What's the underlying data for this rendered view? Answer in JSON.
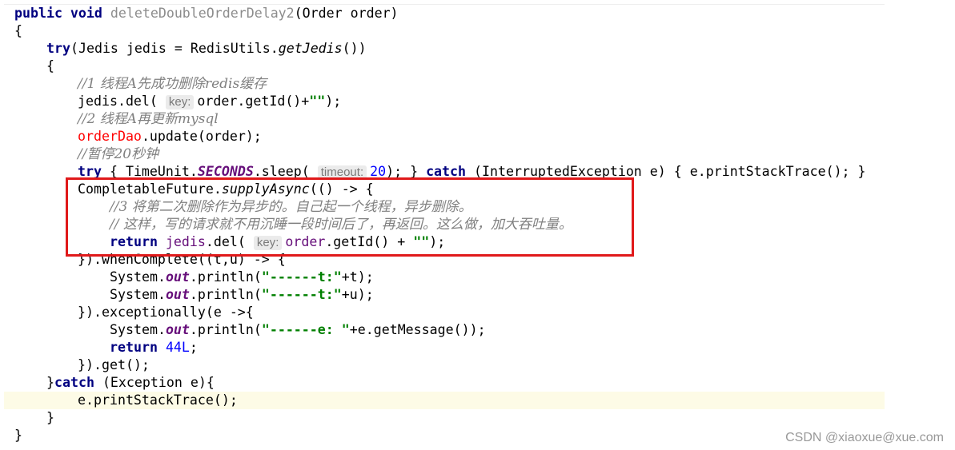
{
  "code": {
    "l1": {
      "kw": "public void ",
      "name": "deleteDoubleOrderDelay2",
      "rest": "(Order order)"
    },
    "l2": "{",
    "l3": {
      "kw": "try",
      "a": "(Jedis jedis = RedisUtils.",
      "m": "getJedis",
      "b": "())"
    },
    "l4": "{",
    "l5": "//1 线程A先成功删除redis缓存",
    "l6": {
      "a": "jedis.del( ",
      "hint_key": "key",
      "b": "order.getId()+",
      "s": "\"\"",
      "c": ");"
    },
    "l7": "//2 线程A再更新mysql",
    "l8": {
      "field": "orderDao",
      "rest": ".update(order);"
    },
    "l9": "//暂停20秒钟",
    "l10": {
      "kw1": "try",
      "a": " { TimeUnit.",
      "sf": "SECONDS",
      "b": ".sleep( ",
      "hint_key": "timeout",
      "num": "20",
      "c": "); } ",
      "kw2": "catch",
      "d": " (InterruptedException e) { e.printStackTrace(); }"
    },
    "l11": {
      "a": "CompletableFuture.",
      "m": "supplyAsync",
      "b": "(() -> {"
    },
    "l12": "//3 将第二次删除作为异步的。自己起一个线程，异步删除。",
    "l13": "// 这样，写的请求就不用沉睡一段时间后了，再返回。这么做，加大吞吐量。",
    "l14": {
      "kw": "return ",
      "local": "jedis",
      "a": ".del( ",
      "hint_key": "key",
      "local2": "order",
      "b": ".getId() + ",
      "s": "\"\"",
      "c": ");"
    },
    "l15": "}).whenComplete((t,u) -> {",
    "l16": {
      "a": "System.",
      "sf": "out",
      "b": ".println(",
      "s": "\"------t:\"",
      "c": "+t);"
    },
    "l17": {
      "a": "System.",
      "sf": "out",
      "b": ".println(",
      "s": "\"------t:\"",
      "c": "+u);"
    },
    "l18": "}).exceptionally(e ->{",
    "l19": {
      "a": "System.",
      "sf": "out",
      "b": ".println(",
      "s": "\"------e: \"",
      "c": "+e.getMessage());"
    },
    "l20": {
      "kw": "return ",
      "num": "44L",
      "c": ";"
    },
    "l21": "}).get();",
    "l22": {
      "a": "}",
      "kw": "catch",
      "b": " (Exception e){"
    },
    "l23": "e.printStackTrace();",
    "l24": "}",
    "l25": "}"
  },
  "watermark": "CSDN @xiaoxue@xue.com",
  "colors": {
    "keyword": "#000080",
    "comment": "#808080",
    "string": "#008000",
    "number": "#0000ff",
    "field": "#660e7a",
    "highlight_box": "#e0191a",
    "current_line": "#fdfbe6"
  }
}
